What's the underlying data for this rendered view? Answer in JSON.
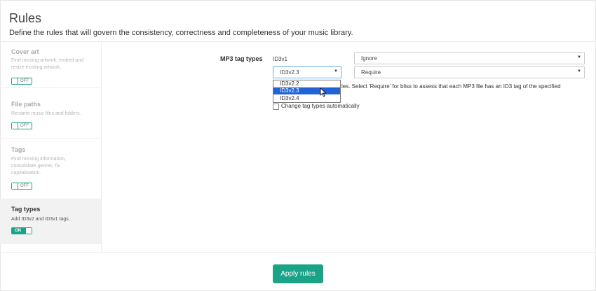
{
  "page": {
    "title": "Rules",
    "description": "Define the rules that will govern the consistency, correctness and completeness of your music library."
  },
  "sidebar": {
    "items": [
      {
        "title": "Cover art",
        "desc": "Find missing artwork, embed and resize existing artwork.",
        "toggle": "OFF"
      },
      {
        "title": "File paths",
        "desc": "Rename music files and folders.",
        "toggle": "OFF"
      },
      {
        "title": "Tags",
        "desc": "Find missing information, consolidate genres, fix capitalisation.",
        "toggle": "OFF"
      },
      {
        "title": "Tag types",
        "desc": "Add ID3v2 and ID3v1 tags.",
        "toggle": "ON"
      }
    ]
  },
  "main": {
    "label": "MP3 tag types",
    "id3v1_label": "ID3v1",
    "id3v1_select": "Ignore",
    "id3v2_select": "ID3v2.3",
    "id3v2_action": "Require",
    "dropdown_options": [
      "ID3v2.2",
      "ID3v2.3",
      "ID3v2.4"
    ],
    "selected_option": "ID3v2.3",
    "help_text": "les. Select 'Require' for bliss to assess that each MP3 file has an ID3 tag of the specified",
    "help_text_cont": "",
    "checkbox_label": "Change tag types automatically"
  },
  "footer": {
    "apply_label": "Apply rules"
  },
  "colors": {
    "accent": "#1aa386",
    "selection": "#1f63d6"
  }
}
